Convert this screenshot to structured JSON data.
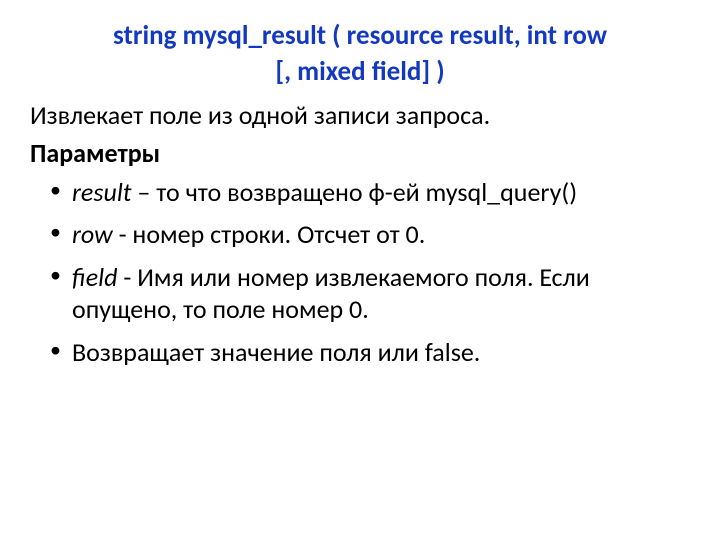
{
  "signature": {
    "line1": "string mysql_result ( resource result, int row",
    "line2": "[, mixed field] )"
  },
  "description": "Извлекает поле из одной записи запроса.",
  "params_heading": "Параметры",
  "params": [
    {
      "name": "result",
      "text": " – то что возвращено ф-ей mysql_query()"
    },
    {
      "name": "row",
      "text": " - номер строки. Отсчет от 0."
    },
    {
      "name": "field",
      "text": " - Имя или номер извлекаемого поля. Если опущено, то поле номер 0."
    }
  ],
  "return_note": "Возвращает значение поля или false."
}
